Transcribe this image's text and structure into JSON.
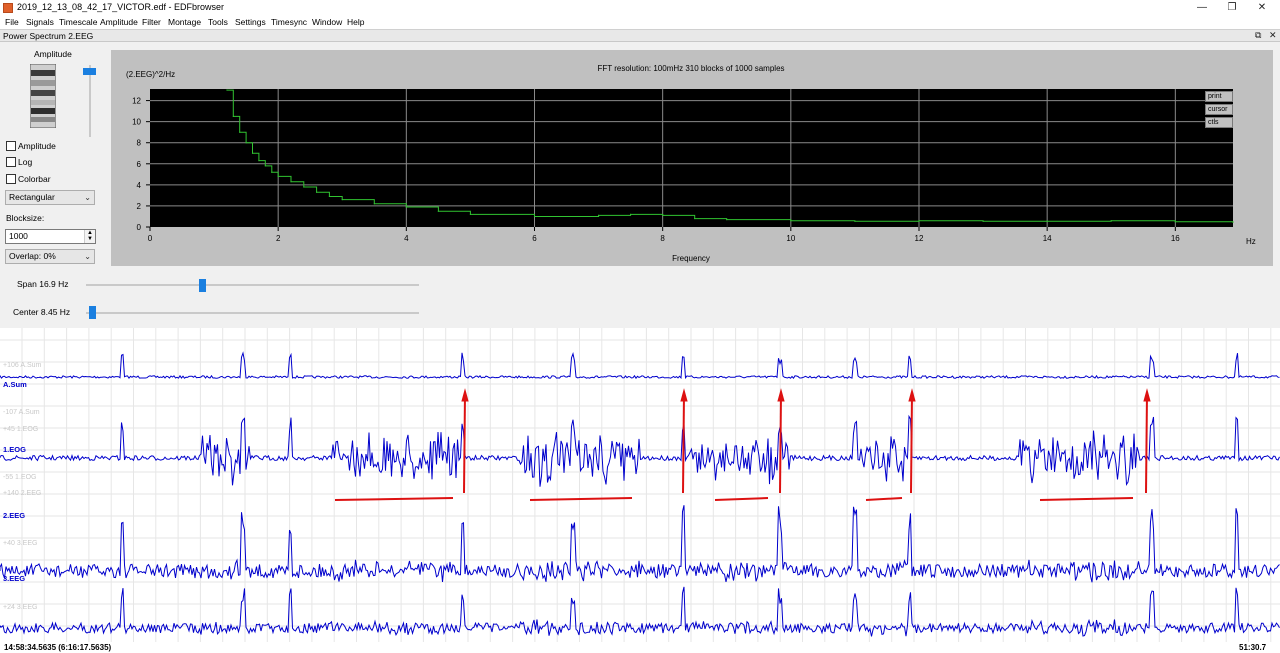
{
  "window": {
    "title": "2019_12_13_08_42_17_VICTOR.edf - EDFbrowser",
    "minimize_glyph": "—",
    "maximize_glyph": "❐",
    "close_glyph": "✕"
  },
  "menu": [
    "File",
    "Signals",
    "Timescale",
    "Amplitude",
    "Filter",
    "Montage",
    "Tools",
    "Settings",
    "Timesync",
    "Window",
    "Help"
  ],
  "subwindow": {
    "title": "Power Spectrum 2.EEG",
    "restore_glyph": "⧉",
    "close_glyph": "✕"
  },
  "controls": {
    "amplitude_label": "Amplitude",
    "checkboxes": [
      "Amplitude",
      "Log",
      "Colorbar"
    ],
    "window_function": "Rectangular",
    "blocksize_label": "Blocksize:",
    "blocksize_value": "1000",
    "overlap": "Overlap: 0%",
    "span_label": "Span 16.9 Hz",
    "center_label": "Center 8.45 Hz",
    "amplitude_slider_level": 0.95,
    "span_slider_fraction": 0.34,
    "center_slider_fraction": 0.01
  },
  "plot": {
    "fft_info": "FFT resolution: 100mHz   310 blocks of 1000 samples",
    "buttons": [
      "print",
      "cursor",
      "ctls"
    ]
  },
  "chart_data": {
    "type": "line",
    "ylabel": "(2.EEG)^2/Hz",
    "xlabel": "Frequency",
    "x_unit": "Hz",
    "xlim": [
      0,
      16.9
    ],
    "ylim": [
      0,
      13.1
    ],
    "x_ticks": [
      "0",
      "2",
      "4",
      "6",
      "8",
      "10",
      "12",
      "14",
      "16"
    ],
    "y_ticks": [
      "0",
      "2",
      "4",
      "6",
      "8",
      "10",
      "12"
    ],
    "grid": true,
    "line_color": "#31c431",
    "x": [
      1.2,
      1.3,
      1.4,
      1.5,
      1.6,
      1.7,
      1.8,
      1.9,
      2.0,
      2.2,
      2.4,
      2.6,
      2.8,
      3.0,
      3.5,
      4.0,
      4.5,
      5.0,
      6.0,
      7.0,
      7.5,
      8.0,
      8.5,
      9.0,
      10.0,
      11.0,
      12.0,
      13.0,
      14.0,
      15.0,
      16.0,
      16.9
    ],
    "values": [
      13.0,
      10.5,
      9.0,
      8.0,
      7.0,
      6.3,
      5.8,
      5.2,
      4.8,
      4.3,
      3.8,
      3.3,
      2.9,
      2.6,
      2.2,
      1.9,
      1.5,
      1.2,
      1.0,
      1.1,
      1.2,
      1.1,
      0.8,
      0.7,
      0.6,
      0.55,
      0.6,
      0.55,
      0.55,
      0.6,
      0.5,
      0.45
    ]
  },
  "signals": {
    "channels": [
      "A.Sum",
      "1.EOG",
      "2.EEG",
      "3.EEG"
    ],
    "scale_labels": [
      "+106 A.Sum",
      "-107 A.Sum",
      "+45 1.EOG",
      "-55 1.EOG",
      "+140 2.EEG",
      "+40 3.EEG",
      "+24 3.EEG"
    ],
    "trace_color": "#0000cc",
    "annotation_color": "#dd1111"
  },
  "status": {
    "left": "14:58:34.5635 (6:16:17.5635)",
    "right": "51:30.7"
  }
}
